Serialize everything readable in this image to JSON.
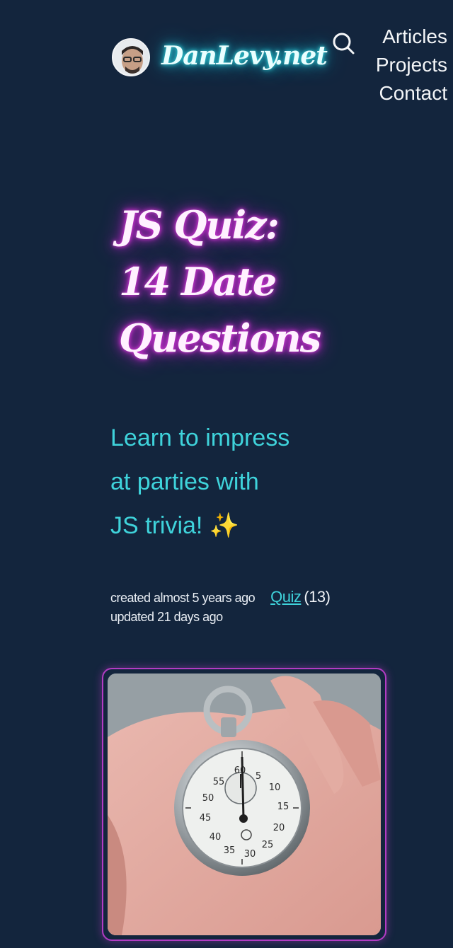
{
  "header": {
    "site_name": "DanLevy.net",
    "nav": [
      "Articles",
      "Projects",
      "Contact"
    ]
  },
  "article": {
    "title_lines": [
      "JS Quiz:",
      "14 Date",
      "Questions"
    ],
    "subtitle_lines": [
      "Learn to impress",
      "at parties with",
      "JS trivia! ✨"
    ],
    "created": "created almost 5 years ago",
    "updated": "updated 21 days ago",
    "tag_label": "Quiz",
    "tag_count": "(13)"
  },
  "stopwatch_numbers": [
    "60",
    "5",
    "10",
    "15",
    "20",
    "25",
    "30",
    "35",
    "40",
    "45",
    "50",
    "55"
  ],
  "colors": {
    "background": "#13253d",
    "accent_cyan": "#3fd3db",
    "accent_magenta": "#c42ad0"
  },
  "icons": {
    "search": "search-icon"
  }
}
